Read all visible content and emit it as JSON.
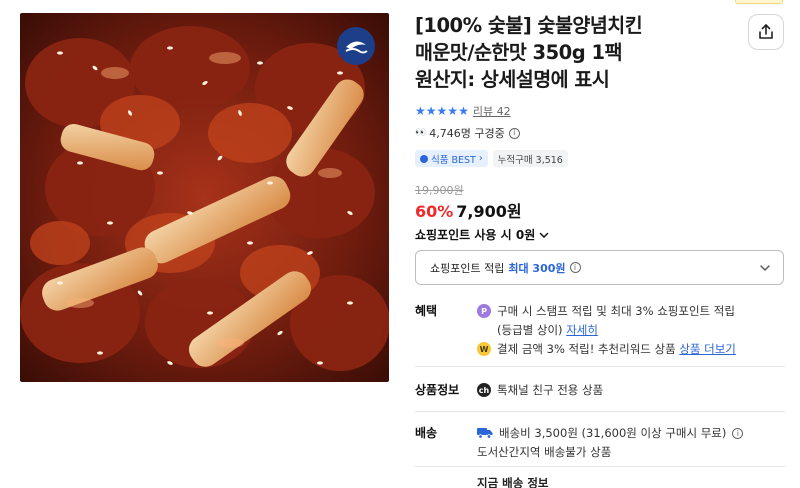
{
  "product": {
    "title_lines": [
      "[100% 숯불] 숯불양념치킨",
      "매운맛/순한맛 350g 1팩",
      "원산지: 상세설명에 표시"
    ],
    "image_icon": "spicy-chicken-tteokbokki-photo",
    "brand_logo_icon": "fish-wave-logo-icon"
  },
  "rating": {
    "stars": 5,
    "review_label": "리뷰 42"
  },
  "viewers": {
    "text": "4,746명 구경중"
  },
  "badges": {
    "best": "식품 BEST",
    "purchases": "누적구매 3,516"
  },
  "price": {
    "original": "19,900원",
    "discount": "60%",
    "sale": "7,900원"
  },
  "point_toggle": {
    "label": "쇼핑포인트 사용 시 0원"
  },
  "point_box": {
    "prefix": "쇼핑포인트 적립",
    "max": "최대 300원"
  },
  "benefit": {
    "label": "혜택",
    "line1": "구매 시 스탬프 적립 및 최대 3% 쇼핑포인트 적립",
    "line1b_prefix": "(등급별 상이)",
    "line1b_link": "자세히",
    "line2_prefix": "결제 금액 3% 적립! 추천리워드 상품",
    "line2_link": "상품 더보기"
  },
  "product_info": {
    "label": "상품정보",
    "text": "톡채널 친구 전용 상품"
  },
  "delivery": {
    "label": "배송",
    "line1": "배송비 3,500원 (31,600원 이상 구매시 무료)",
    "line2": "도서산간지역 배송불가 상품",
    "cutoff": "지금 배송 정보"
  },
  "colors": {
    "accent_blue": "#2b66d9",
    "discount_red": "#f02a2a",
    "star_blue": "#3a7bf5"
  }
}
